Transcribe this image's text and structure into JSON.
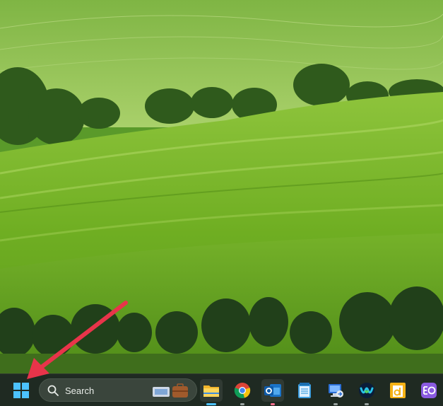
{
  "desktop": {
    "wallpaper_icon": "green-hills-wallpaper"
  },
  "taskbar": {
    "start_icon": "windows-logo-icon",
    "search": {
      "label": "Search"
    },
    "pinned_apps": [
      {
        "icon": "file-explorer-icon",
        "running": true
      },
      {
        "icon": "chrome-icon",
        "running": true
      },
      {
        "icon": "outlook-icon",
        "running": true
      },
      {
        "icon": "notepad-icon",
        "running": false
      },
      {
        "icon": "remote-desktop-icon",
        "running": true
      },
      {
        "icon": "webex-icon",
        "running": true
      },
      {
        "icon": "app-d-icon",
        "running": false
      },
      {
        "icon": "eo-app-icon",
        "running": false
      }
    ]
  },
  "annotation": {
    "arrow_color": "#e8344a"
  }
}
